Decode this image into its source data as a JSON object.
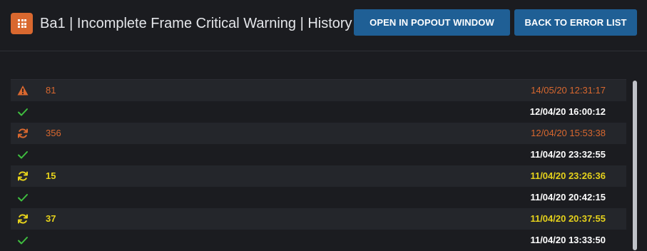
{
  "header": {
    "title": "Ba1 | Incomplete Frame Critical Warning | History",
    "app_icon": "grid-icon",
    "popout_label": "OPEN IN POPOUT WINDOW",
    "back_label": "BACK TO ERROR LIST"
  },
  "colors": {
    "accent_orange": "#d9682f",
    "accent_yellow": "#e6d21b",
    "ok_green": "#3fbf3f",
    "button_blue": "#1f5f95",
    "background": "#1b1c20"
  },
  "history": [
    {
      "icon": "warning-icon",
      "count": "81",
      "time": "14/05/20 12:31:17",
      "status": "warning"
    },
    {
      "icon": "check-icon",
      "count": "",
      "time": "12/04/20 16:00:12",
      "status": "ok"
    },
    {
      "icon": "refresh-icon",
      "count": "356",
      "time": "12/04/20 15:53:38",
      "status": "recurring-orange"
    },
    {
      "icon": "check-icon",
      "count": "",
      "time": "11/04/20 23:32:55",
      "status": "ok"
    },
    {
      "icon": "refresh-icon",
      "count": "15",
      "time": "11/04/20 23:26:36",
      "status": "recurring-yellow"
    },
    {
      "icon": "check-icon",
      "count": "",
      "time": "11/04/20 20:42:15",
      "status": "ok"
    },
    {
      "icon": "refresh-icon",
      "count": "37",
      "time": "11/04/20 20:37:55",
      "status": "recurring-yellow"
    },
    {
      "icon": "check-icon",
      "count": "",
      "time": "11/04/20 13:33:50",
      "status": "ok"
    }
  ]
}
